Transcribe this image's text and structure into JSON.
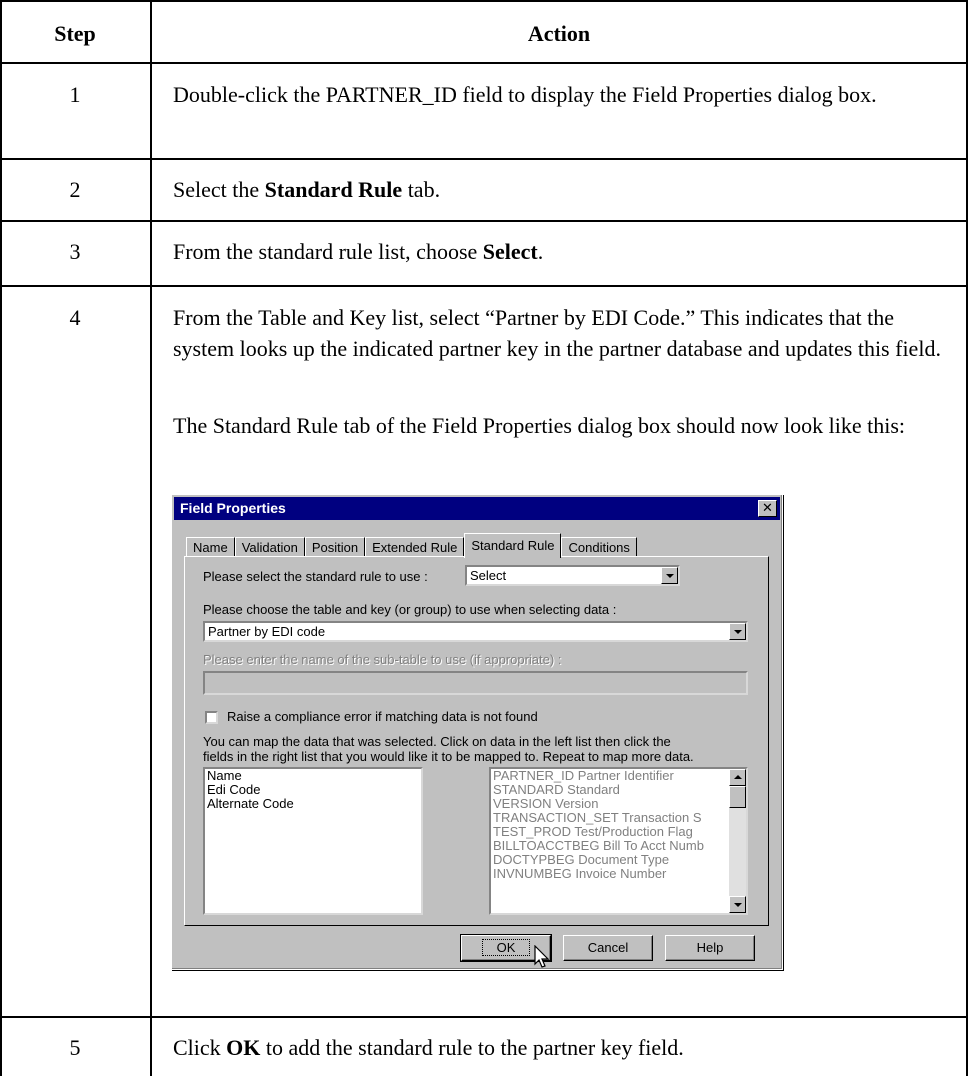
{
  "table": {
    "header": {
      "step": "Step",
      "action": "Action"
    },
    "rows": [
      {
        "step": "1",
        "text": "Double-click the PARTNER_ID field to display the Field Properties dialog box."
      },
      {
        "step": "2",
        "pre": "Select the ",
        "bold": "Standard Rule",
        "post": " tab."
      },
      {
        "step": "3",
        "pre": "From the standard rule list, choose ",
        "bold": "Select",
        "post": "."
      },
      {
        "step": "4",
        "para1": "From the Table and Key list, select “Partner by EDI Code.” This indicates that the system looks up the indicated partner key in the partner database and updates this field.",
        "para2": "The Standard Rule tab of the Field Properties dialog box should now look like this:"
      },
      {
        "step": "5",
        "pre": "Click ",
        "bold": "OK",
        "post": " to add the standard rule to the partner key field."
      }
    ]
  },
  "dialog": {
    "title": "Field Properties",
    "close_glyph": "✕",
    "tabs": [
      "Name",
      "Validation",
      "Position",
      "Extended Rule",
      "Standard Rule",
      "Conditions"
    ],
    "active_tab": "Standard Rule",
    "rule_label": "Please select the standard rule to use :",
    "rule_value": "Select",
    "table_label": "Please choose the table and key (or group) to use when selecting data :",
    "table_value": "Partner by EDI code",
    "subtable_label": "Please enter the name of the sub-table to use (if appropriate) :",
    "subtable_value": "",
    "checkbox_label": "Raise a compliance error if matching data is not found",
    "checkbox_checked": false,
    "map_help_line1": "You can map the data that was selected. Click on data in the left list then click the",
    "map_help_line2": "fields in the right list that you would like it to be mapped to. Repeat to map more data.",
    "left_list": [
      "Name",
      "Edi Code",
      "Alternate Code"
    ],
    "right_list": [
      "PARTNER_ID Partner Identifier",
      "STANDARD Standard",
      "VERSION Version",
      "TRANSACTION_SET Transaction S",
      "TEST_PROD Test/Production Flag",
      "BILLTOACCTBEG Bill To Acct Numb",
      "DOCTYPBEG Document Type",
      "INVNUMBEG Invoice Number"
    ],
    "buttons": {
      "ok": "OK",
      "cancel": "Cancel",
      "help": "Help"
    }
  }
}
